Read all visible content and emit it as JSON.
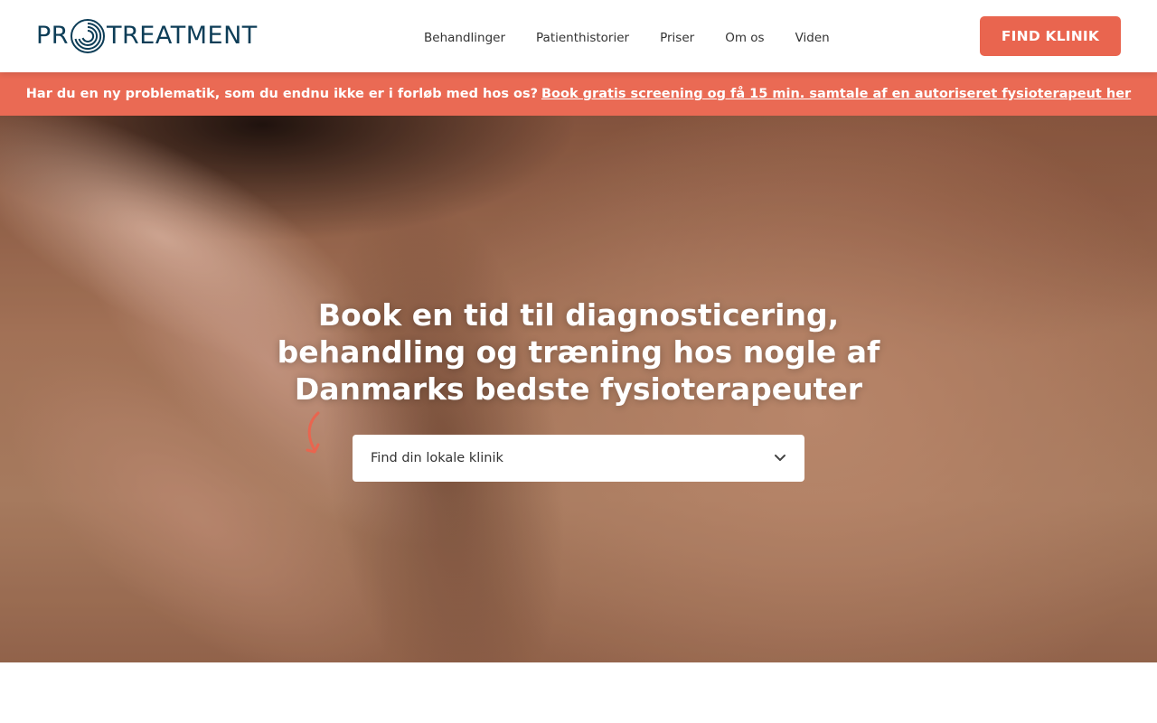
{
  "header": {
    "logo": {
      "prefix": "PR",
      "suffix": "TREATMENT",
      "color": "#0d3d57"
    },
    "nav": [
      {
        "label": "Behandlinger"
      },
      {
        "label": "Patienthistorier"
      },
      {
        "label": "Priser"
      },
      {
        "label": "Om os"
      },
      {
        "label": "Viden"
      }
    ],
    "cta_label": "FIND KLINIK"
  },
  "announcement": {
    "text": "Har du en ny problematik, som du endnu ikke er i forløb med hos os?",
    "link_label": "Book gratis screening og få 15 min. samtale af en autoriseret fysioterapeut her"
  },
  "hero": {
    "title": "Book en tid til diagnosticering, behandling og træning hos nogle af Danmarks bedste fysioterapeuter",
    "select": {
      "selected": "Find din lokale klinik",
      "icon": "chevron-down-icon"
    },
    "arrow_icon": "curved-arrow-icon"
  },
  "colors": {
    "brand_navy": "#0d3d57",
    "accent_coral": "#e9654f",
    "announcement_bg": "#ea6a54"
  }
}
